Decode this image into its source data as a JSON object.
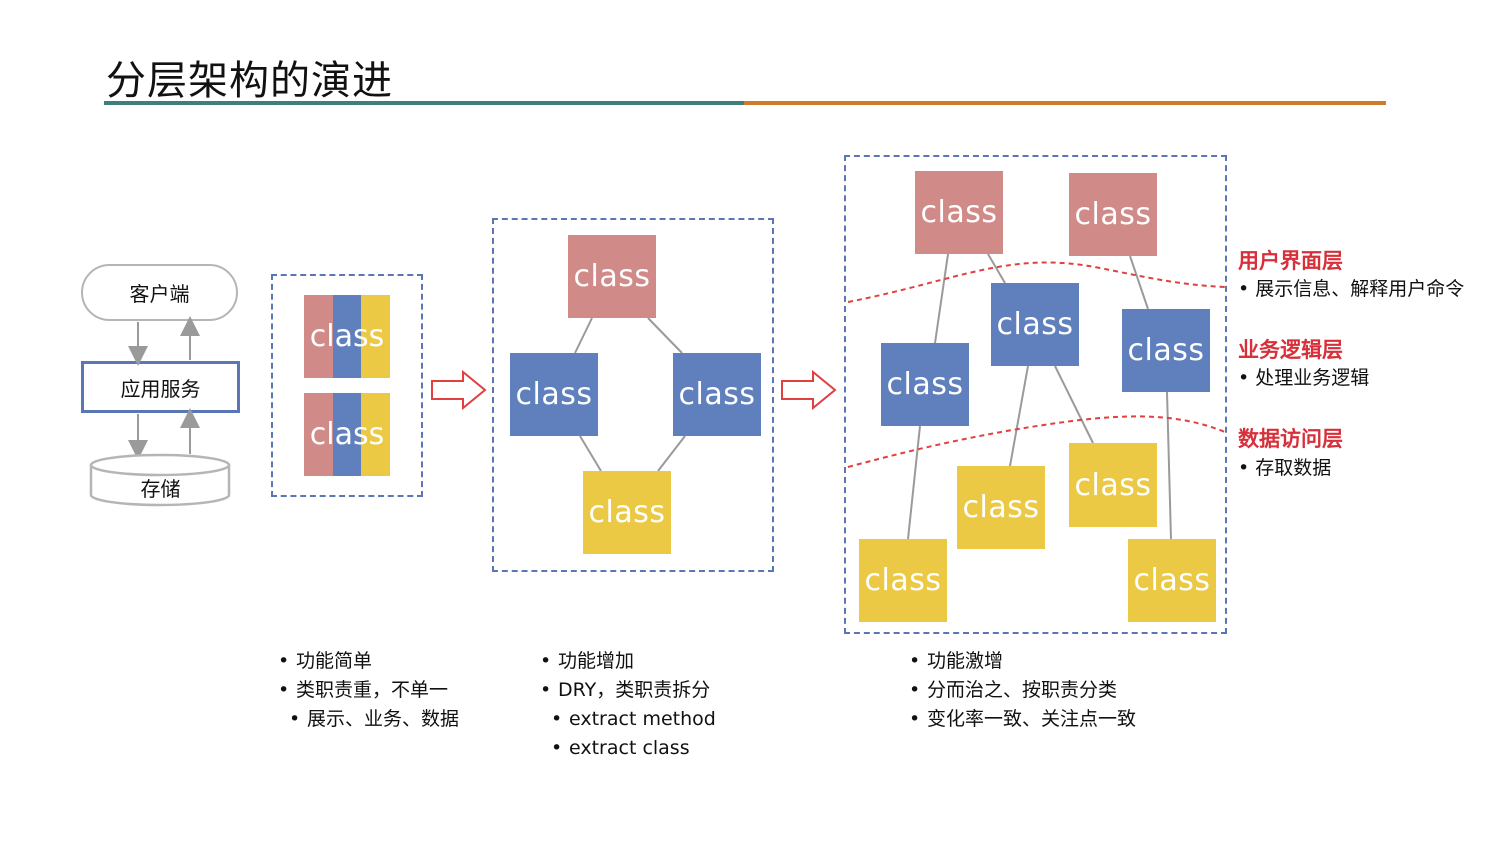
{
  "title": "分层架构的演进",
  "colors": {
    "teal_rule": "#3e7f7b",
    "orange_rule": "#d07a2b",
    "class_pink": "#d08a88",
    "class_blue": "#5f80bd",
    "class_yellow": "#ecc944",
    "dashed_frame": "#5a76b6",
    "layer_red": "#d7303a",
    "arrow_red": "#e04040"
  },
  "left_stack": {
    "client": "客户端",
    "service": "应用服务",
    "storage": "存储"
  },
  "class_label": "class",
  "layers": [
    {
      "name": "用户界面层",
      "desc": "展示信息、解释用户命令"
    },
    {
      "name": "业务逻辑层",
      "desc": "处理业务逻辑"
    },
    {
      "name": "数据访问层",
      "desc": "存取数据"
    }
  ],
  "notes": {
    "stage1": [
      "功能简单",
      "类职责重，不单一"
    ],
    "stage1_sub": [
      "展示、业务、数据"
    ],
    "stage2": [
      "功能增加",
      "DRY，类职责拆分"
    ],
    "stage2_sub": [
      "extract method",
      "extract class"
    ],
    "stage3": [
      "功能激增",
      "分而治之、按职责分类",
      "变化率一致、关注点一致"
    ]
  }
}
